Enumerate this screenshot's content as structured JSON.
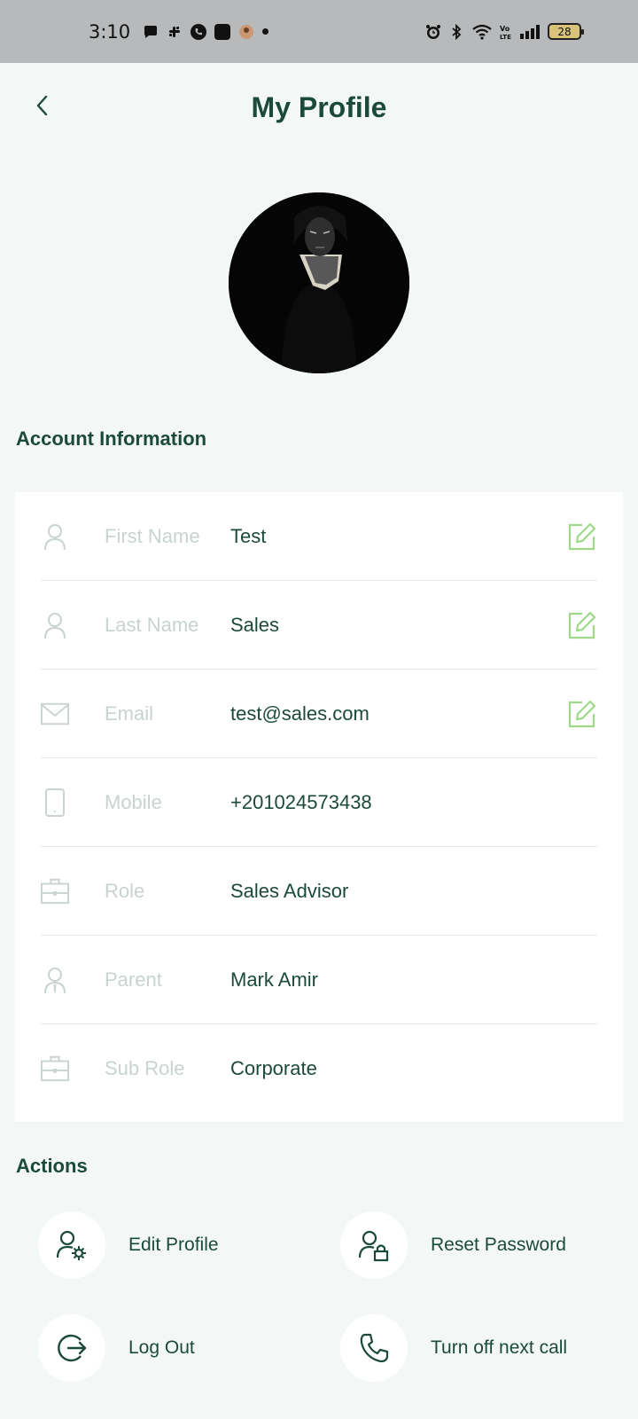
{
  "status_bar": {
    "time": "3:10",
    "battery": "28",
    "left_icons": [
      "chat-bubble-icon",
      "slack-icon",
      "phone-call-icon",
      "app-square-icon",
      "avatar-notification-icon",
      "more-dot-icon"
    ],
    "right_icons": [
      "alarm-icon",
      "bluetooth-icon",
      "wifi-icon",
      "volte-icon",
      "signal-icon",
      "battery-icon"
    ]
  },
  "header": {
    "title": "My Profile"
  },
  "account": {
    "section_title": "Account Information",
    "rows": [
      {
        "label": "First Name",
        "value": "Test",
        "icon": "user-icon",
        "editable": true
      },
      {
        "label": "Last Name",
        "value": "Sales",
        "icon": "user-icon",
        "editable": true
      },
      {
        "label": "Email",
        "value": "test@sales.com",
        "icon": "mail-icon",
        "editable": true
      },
      {
        "label": "Mobile",
        "value": "+201024573438",
        "icon": "mobile-icon",
        "editable": false
      },
      {
        "label": "Role",
        "value": "Sales Advisor",
        "icon": "briefcase-icon",
        "editable": false
      },
      {
        "label": "Parent",
        "value": "Mark Amir",
        "icon": "user-tie-icon",
        "editable": false
      },
      {
        "label": "Sub Role",
        "value": "Corporate",
        "icon": "briefcase-icon",
        "editable": false
      }
    ]
  },
  "actions": {
    "section_title": "Actions",
    "items": [
      {
        "label": "Edit Profile",
        "icon": "user-gear-icon"
      },
      {
        "label": "Reset Password",
        "icon": "user-lock-icon"
      },
      {
        "label": "Log Out",
        "icon": "logout-icon"
      },
      {
        "label": "Turn off next call",
        "icon": "phone-icon"
      }
    ]
  },
  "colors": {
    "primary": "#1b4a3c",
    "edit_icon": "#9ed98a",
    "muted_label": "#c9d3d0",
    "background": "#f3f8f7",
    "status_bar": "#b7b9ba"
  }
}
